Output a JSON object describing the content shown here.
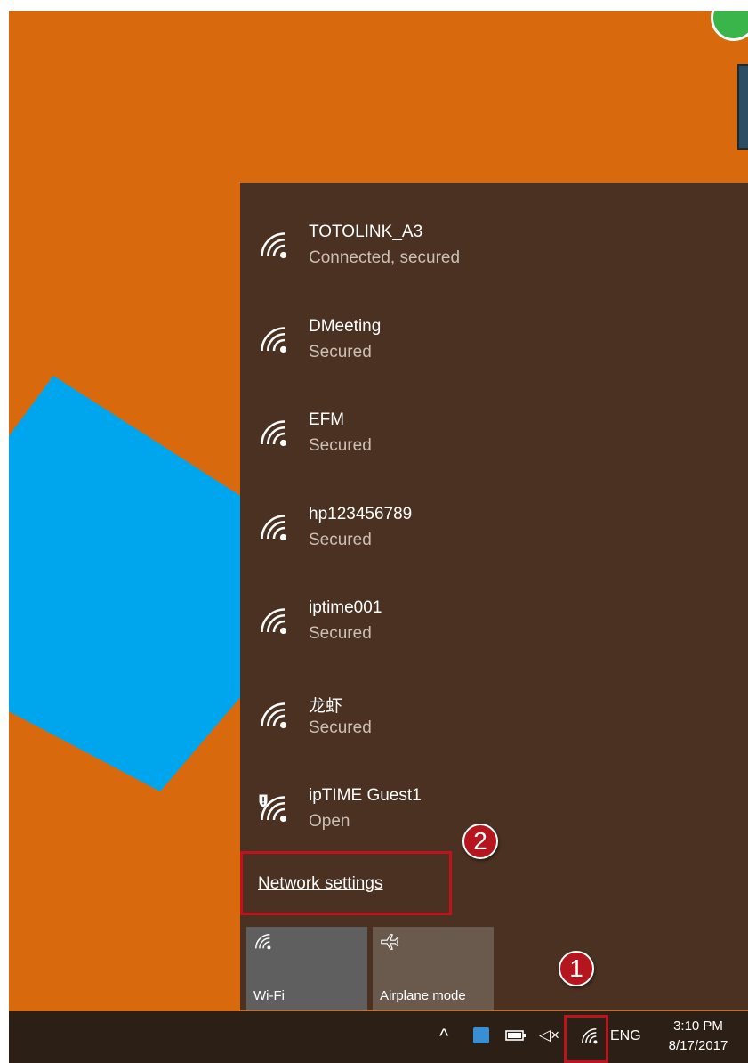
{
  "wifi_networks": [
    {
      "name": "TOTOLINK_A3",
      "status": "Connected, secured"
    },
    {
      "name": "DMeeting",
      "status": "Secured"
    },
    {
      "name": "EFM",
      "status": "Secured"
    },
    {
      "name": "hp123456789",
      "status": "Secured"
    },
    {
      "name": "iptime001",
      "status": "Secured"
    },
    {
      "name": "龙虾",
      "status": "Secured"
    },
    {
      "name": "ipTIME Guest1",
      "status": "Open"
    }
  ],
  "network_settings_label": "Network settings",
  "quick_actions": {
    "wifi_label": "Wi-Fi",
    "airplane_label": "Airplane mode"
  },
  "taskbar": {
    "chevron": "^",
    "volume": "◁×",
    "language": "ENG",
    "time": "3:10 PM",
    "date": "8/17/2017"
  },
  "annotations": {
    "step_1": "1",
    "step_2": "2"
  },
  "colors": {
    "desktop": "#d9690d",
    "flyout": "#4a3121",
    "highlight": "#c0121b",
    "wallpaper_shape": "#00a6ed"
  },
  "icons": [
    "wifi-signal-icon",
    "wifi-warning-icon",
    "airplane-icon",
    "store-icon",
    "battery-icon",
    "volume-muted-icon"
  ]
}
